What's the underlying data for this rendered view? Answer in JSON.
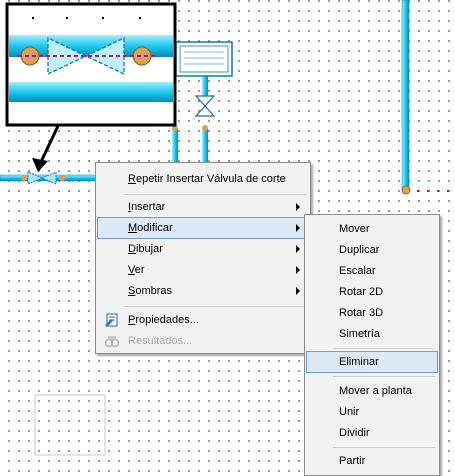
{
  "context_menu": {
    "items": [
      {
        "label": "Repetir Insertar Válvula de corte",
        "key": "R",
        "rest": "epetir Insertar Válvula de corte",
        "submenu": false
      },
      {
        "label": "Insertar",
        "key": "I",
        "rest": "nsertar",
        "submenu": true
      },
      {
        "label": "Modificar",
        "key": "M",
        "rest": "odificar",
        "submenu": true,
        "highlighted": true
      },
      {
        "label": "Dibujar",
        "key": "D",
        "rest": "ibujar",
        "submenu": true
      },
      {
        "label": "Ver",
        "key": "V",
        "rest": "er",
        "submenu": true
      },
      {
        "label": "Sombras",
        "key": "S",
        "rest": "ombras",
        "submenu": true
      },
      {
        "label": "Propiedades...",
        "key": "P",
        "rest": "ropiedades...",
        "icon": "properties-icon"
      },
      {
        "label": "Resultados...",
        "disabled": true,
        "icon": "results-icon"
      }
    ]
  },
  "submenu": {
    "items": [
      {
        "label": "Mover"
      },
      {
        "label": "Duplicar"
      },
      {
        "label": "Escalar"
      },
      {
        "label": "Rotar 2D"
      },
      {
        "label": "Rotar 3D"
      },
      {
        "label": "Simetría"
      },
      {
        "label": "Eliminar",
        "highlighted": true
      },
      {
        "label": "Mover a planta"
      },
      {
        "label": "Unir"
      },
      {
        "label": "Dividir"
      },
      {
        "label": "Partir"
      }
    ]
  },
  "colors": {
    "pipe": "#1ec8ee",
    "pipe_dark": "#0a7fb0",
    "valve": "#6fd0f0",
    "joint": "#d8a058",
    "menu_bg": "#f2f2f2",
    "highlight": "#dde8f6",
    "highlight_border": "#6f9bd1",
    "red_dots": "#d01010"
  }
}
